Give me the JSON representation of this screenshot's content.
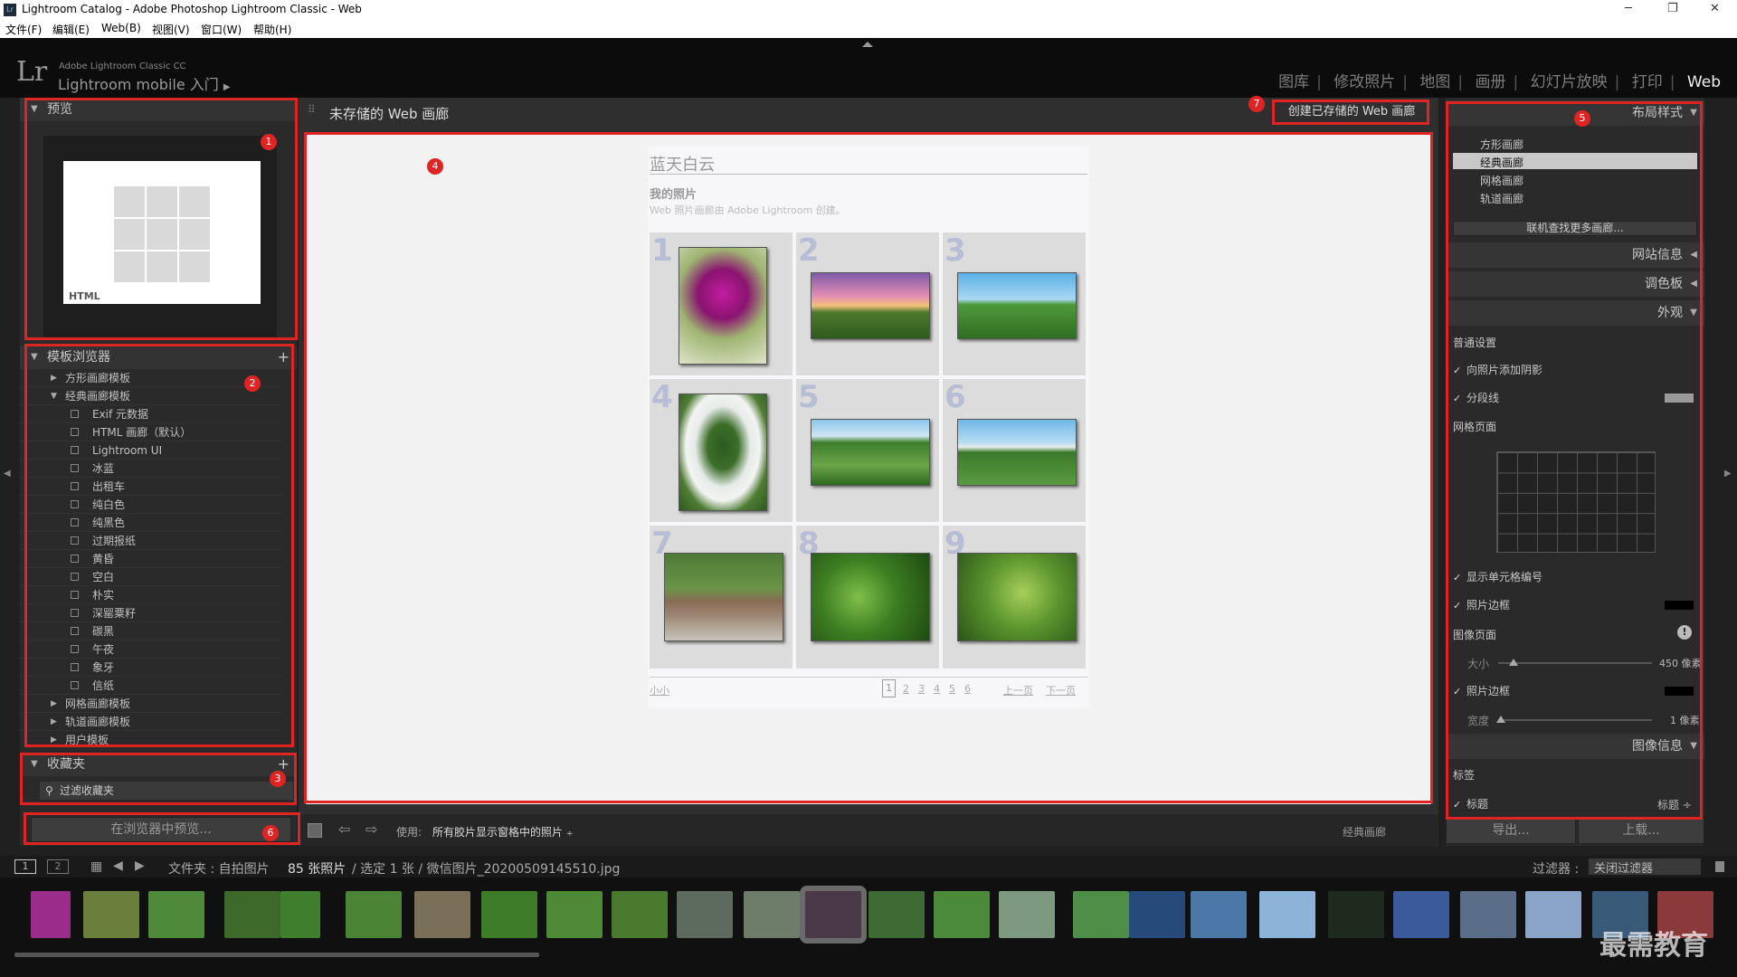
{
  "titlebar": {
    "title": "Lightroom Catalog - Adobe Photoshop Lightroom Classic - Web",
    "minimize": "─",
    "restore": "❐",
    "close": "✕"
  },
  "menubar": {
    "items": [
      "文件(F)",
      "编辑(E)",
      "Web(B)",
      "视图(V)",
      "窗口(W)",
      "帮助(H)"
    ]
  },
  "identity": {
    "lr": "Lr",
    "product": "Adobe Lightroom Classic CC",
    "mobile": "Lightroom mobile 入门"
  },
  "modules": {
    "items": [
      "图库",
      "修改照片",
      "地图",
      "画册",
      "幻灯片放映",
      "打印",
      "Web"
    ],
    "active": "Web"
  },
  "left": {
    "preview_title": "预览",
    "preview_label": "HTML",
    "templates_title": "模板浏览器",
    "templates": [
      {
        "label": "方形画廊模板",
        "type": "folder"
      },
      {
        "label": "经典画廊模板",
        "type": "folder-open"
      },
      {
        "label": "Exif 元数据",
        "type": "item"
      },
      {
        "label": "HTML 画廊（默认）",
        "type": "item"
      },
      {
        "label": "Lightroom UI",
        "type": "item"
      },
      {
        "label": "冰蓝",
        "type": "item"
      },
      {
        "label": "出租车",
        "type": "item"
      },
      {
        "label": "纯白色",
        "type": "item"
      },
      {
        "label": "纯黑色",
        "type": "item"
      },
      {
        "label": "过期报纸",
        "type": "item"
      },
      {
        "label": "黄昏",
        "type": "item"
      },
      {
        "label": "空白",
        "type": "item"
      },
      {
        "label": "朴实",
        "type": "item"
      },
      {
        "label": "深罂粟籽",
        "type": "item"
      },
      {
        "label": "碳黑",
        "type": "item"
      },
      {
        "label": "午夜",
        "type": "item"
      },
      {
        "label": "象牙",
        "type": "item"
      },
      {
        "label": "信纸",
        "type": "item"
      },
      {
        "label": "网格画廊模板",
        "type": "folder"
      },
      {
        "label": "轨道画廊模板",
        "type": "folder"
      },
      {
        "label": "用户模板",
        "type": "folder"
      }
    ],
    "collections_title": "收藏夹",
    "filter_collections": "过滤收藏夹",
    "preview_in_browser": "在浏览器中预览..."
  },
  "center": {
    "header_title": "未存储的 Web 画廊",
    "create_saved": "创建已存储的 Web 画廊",
    "gallery": {
      "site_title": "蓝天白云",
      "collection_title": "我的照片",
      "description": "Web 照片画廊由 Adobe Lightroom 创建。",
      "numbers": [
        "1",
        "2",
        "3",
        "4",
        "5",
        "6",
        "7",
        "8",
        "9"
      ],
      "contact": "小小",
      "pages": [
        "1",
        "2",
        "3",
        "4",
        "5",
        "6"
      ],
      "prev": "上一页",
      "next": "下一页"
    },
    "toolbar": {
      "use_label": "使用:",
      "use_value": "所有胶片显示窗格中的照片",
      "gallery_type": "经典画廊"
    }
  },
  "right": {
    "layout_title": "布局样式",
    "layouts": [
      "方形画廊",
      "经典画廊",
      "网格画廊",
      "轨道画廊"
    ],
    "selected_layout": "经典画廊",
    "find_more": "联机查找更多画廊...",
    "site_info": "网站信息",
    "color_palette": "调色板",
    "appearance": "外观",
    "general": "普通设置",
    "add_shadow": "向照片添加阴影",
    "section_lines": "分段线",
    "grid_pages": "网格页面",
    "show_cell_numbers": "显示单元格编号",
    "photo_borders": "照片边框",
    "image_pages": "图像页面",
    "size_label": "大小",
    "size_value": "450 像素",
    "photo_borders2": "照片边框",
    "width_label": "宽度",
    "width_value": "1 像素",
    "image_info": "图像信息",
    "labels": "标签",
    "title_label": "标题",
    "title_value": "标题 ÷",
    "export": "导出...",
    "upload": "上载..."
  },
  "filmbar": {
    "view1": "1",
    "view2": "2",
    "source_prefix": "文件夹 : 自拍图片",
    "count": "85 张照片",
    "selection": " / 选定 1 张 / 微信图片_20200509145510.jpg",
    "filter_label": "过滤器 :",
    "filter_value": "关闭过滤器"
  },
  "watermark": "最需教育",
  "badges": [
    "1",
    "2",
    "3",
    "4",
    "5",
    "6",
    "7"
  ],
  "colors": {
    "accent": "#e02424",
    "active_module": "#f0f0f0",
    "panel": "#2a2a2a"
  }
}
